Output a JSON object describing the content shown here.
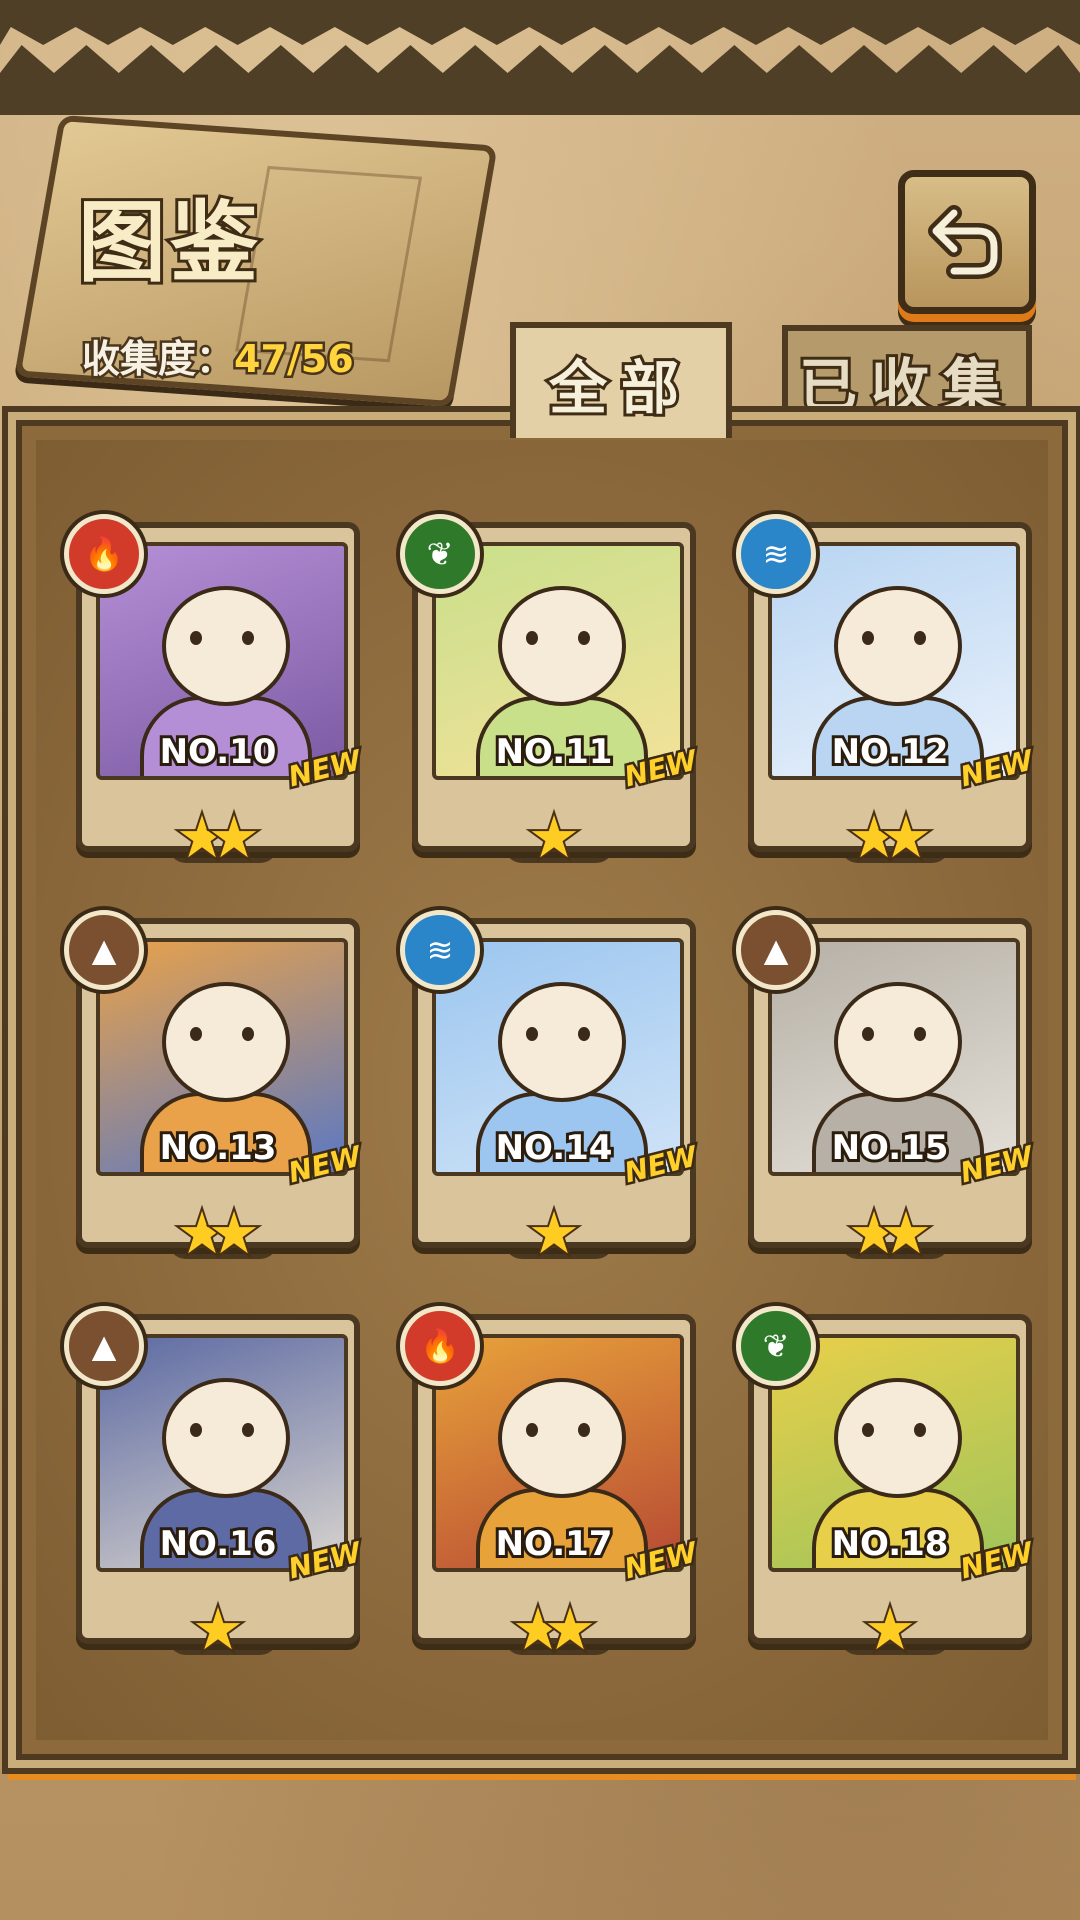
{
  "header": {
    "title": "图鉴",
    "collection_label": "收集度：",
    "collection_value": "47/56",
    "back_icon": "return-arrow-icon"
  },
  "tabs": [
    {
      "label": "全部",
      "active": true
    },
    {
      "label": "已收集",
      "active": false
    }
  ],
  "colors": {
    "accent_orange": "#e88c22",
    "fire": "#d23b2a",
    "nature": "#2f7a2a",
    "water": "#2a86c9",
    "earth": "#7a5030",
    "new_badge": "#ffd02a",
    "star": "#ffcc22"
  },
  "cards": [
    {
      "number": "NO.10",
      "element": "fire",
      "stars": 2,
      "new": "NEW",
      "palette": [
        "#b58fd6",
        "#7b5aa3"
      ]
    },
    {
      "number": "NO.11",
      "element": "nature",
      "stars": 1,
      "new": "NEW",
      "palette": [
        "#c9e08b",
        "#f3e19a"
      ]
    },
    {
      "number": "NO.12",
      "element": "water",
      "stars": 2,
      "new": "NEW",
      "palette": [
        "#b9d5f2",
        "#e9f1fb"
      ]
    },
    {
      "number": "NO.13",
      "element": "earth",
      "stars": 2,
      "new": "NEW",
      "palette": [
        "#e9a24a",
        "#5a78c4"
      ]
    },
    {
      "number": "NO.14",
      "element": "water",
      "stars": 1,
      "new": "NEW",
      "palette": [
        "#9cc6ef",
        "#cfe3f7"
      ]
    },
    {
      "number": "NO.15",
      "element": "earth",
      "stars": 2,
      "new": "NEW",
      "palette": [
        "#b6b0a6",
        "#e4e0d8"
      ]
    },
    {
      "number": "NO.16",
      "element": "earth",
      "stars": 1,
      "new": "NEW",
      "palette": [
        "#5d6aa3",
        "#d8d4ce"
      ]
    },
    {
      "number": "NO.17",
      "element": "fire",
      "stars": 2,
      "new": "NEW",
      "palette": [
        "#e8a23a",
        "#b74a34"
      ]
    },
    {
      "number": "NO.18",
      "element": "nature",
      "stars": 1,
      "new": "NEW",
      "palette": [
        "#e8cf4a",
        "#9fc45a"
      ]
    }
  ]
}
